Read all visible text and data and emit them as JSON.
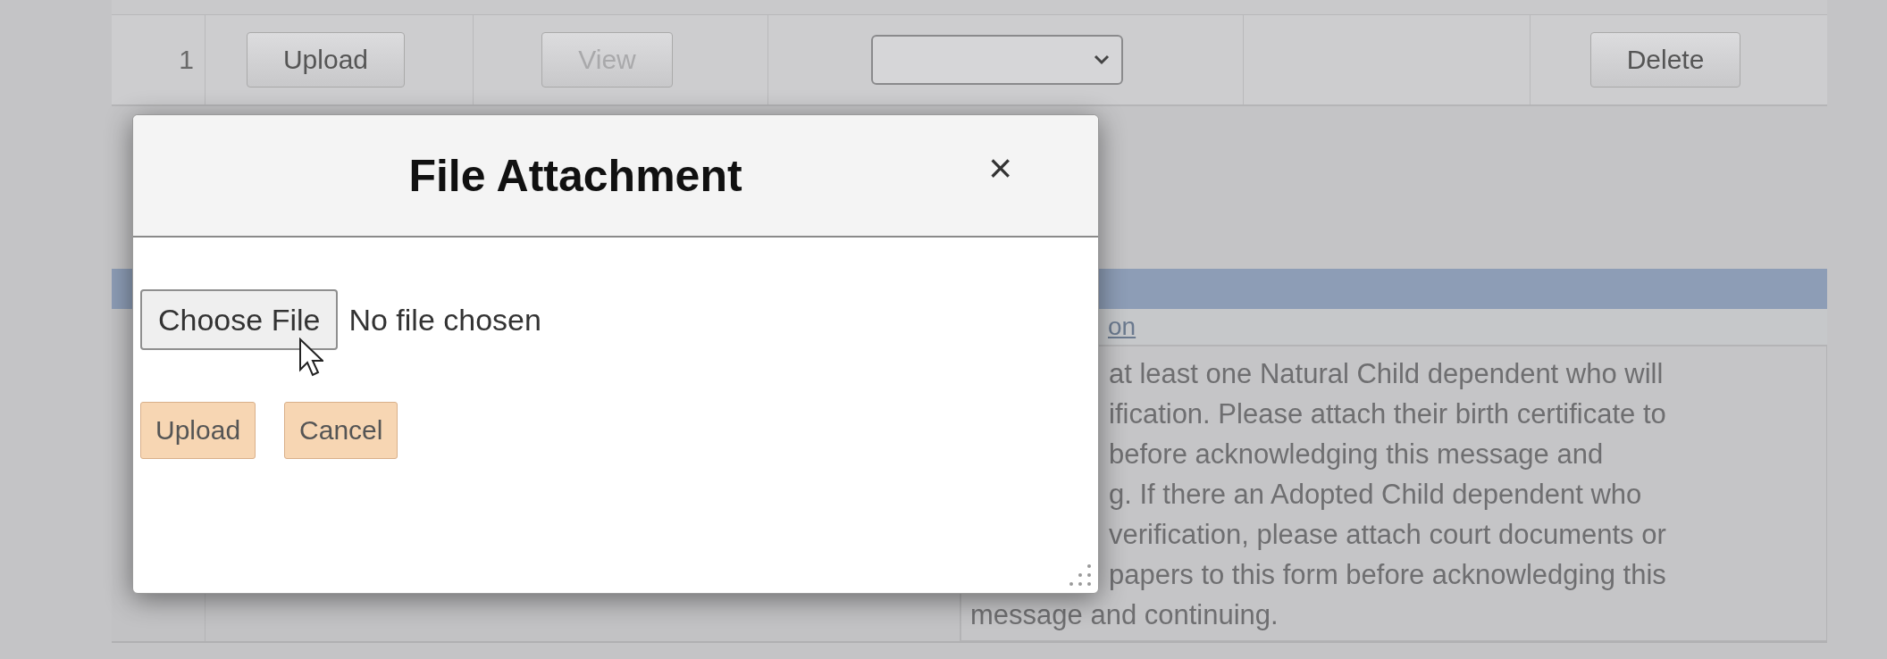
{
  "table": {
    "rows": [
      {
        "number": "1",
        "upload_button": "Upload",
        "view_button": {
          "label": "View",
          "disabled": true
        },
        "delete_button": "Delete"
      }
    ]
  },
  "panel": {
    "column_header": "on",
    "lines": [
      {
        "kind": "clipped",
        "text": "at least one Natural Child dependent who will"
      },
      {
        "kind": "clipped",
        "text": "ification. Please attach their birth certificate to"
      },
      {
        "kind": "clipped",
        "text": "before acknowledging this message and"
      },
      {
        "kind": "clipped",
        "text": "g. If there an Adopted Child dependent who"
      },
      {
        "kind": "clipped",
        "text": "verification, please attach court documents or"
      },
      {
        "kind": "clipped",
        "text": "papers to this form before acknowledging this"
      },
      {
        "kind": "full",
        "text": "message and continuing."
      }
    ]
  },
  "dialog": {
    "title": "File Attachment",
    "close": "×",
    "choose_button": "Choose File",
    "file_status": "No file chosen",
    "buttons": [
      "Upload",
      "Cancel"
    ]
  }
}
